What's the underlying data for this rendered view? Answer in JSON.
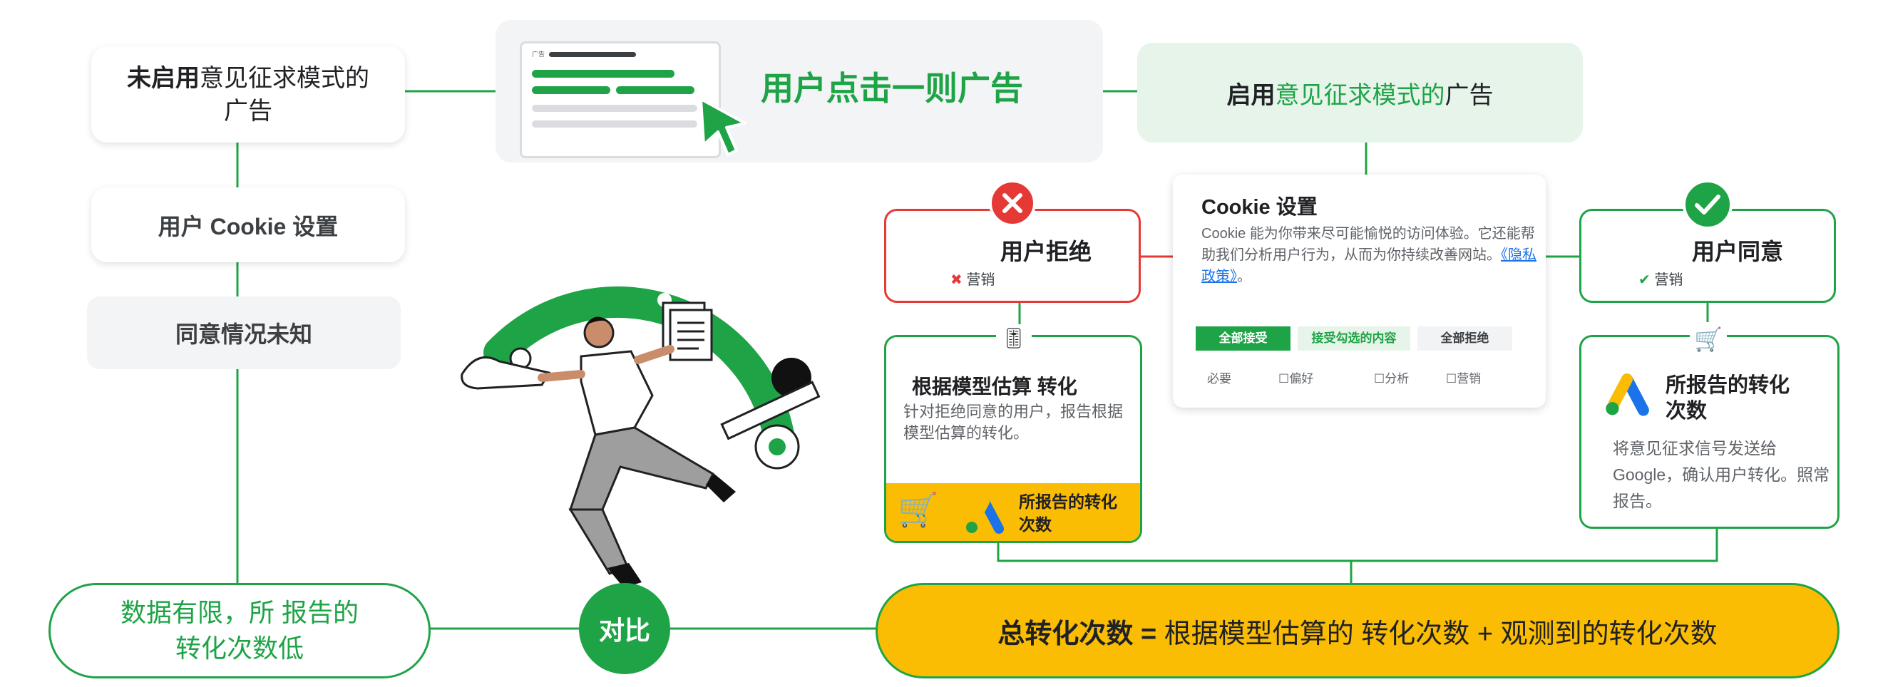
{
  "left": {
    "no_consent_box": {
      "bold": "未启用",
      "rest": "意见征求模式的",
      "line2": "广告"
    },
    "cookie_box": "用户 Cookie 设置",
    "unknown_box": "同意情况未知",
    "limited_box": {
      "line1": "数据有限，所 报告的",
      "line2": "转化次数低"
    }
  },
  "top": {
    "ad_mini_label": "广告",
    "click_title": "用户点击一则广告",
    "with_consent": {
      "bold": "启用",
      "green": "意见征求模式的",
      "rest": "广告"
    }
  },
  "cookie_panel": {
    "title": "Cookie 设置",
    "body_pre": "Cookie 能为你带来尽可能愉悦的访问体验。它还能帮助我们分析用户行为，从而为你持续改善网站。",
    "link": "《隐私政策》",
    "body_post": "。",
    "btn_accept_all": "全部接受",
    "btn_accept_selected": "接受勾选的内容",
    "btn_reject_all": "全部拒绝",
    "checkboxes": [
      "必要",
      "偏好",
      "分析",
      "营销"
    ]
  },
  "reject": {
    "title": "用户拒绝",
    "item": "营销"
  },
  "accept": {
    "title": "用户同意",
    "item": "营销"
  },
  "modeled": {
    "title": "根据模型估算 转化",
    "body": "针对拒绝同意的用户，报告根据模型估算的转化。"
  },
  "reported_small": {
    "line1": "所报告的转化",
    "line2": "次数"
  },
  "reported_right": {
    "title_line1": "所报告的转化",
    "title_line2": "次数",
    "body": "将意见征求信号发送给 Google，确认用户转化。照常报告。"
  },
  "compare": "对比",
  "total": {
    "bold": "总转化次数 =",
    "rest": " 根据模型估算的 转化次数 + 观测到的转化次数"
  },
  "colors": {
    "green": "#1ea446",
    "light_green": "#e6f4ea",
    "red": "#e53935",
    "yellow": "#fbbc04"
  }
}
